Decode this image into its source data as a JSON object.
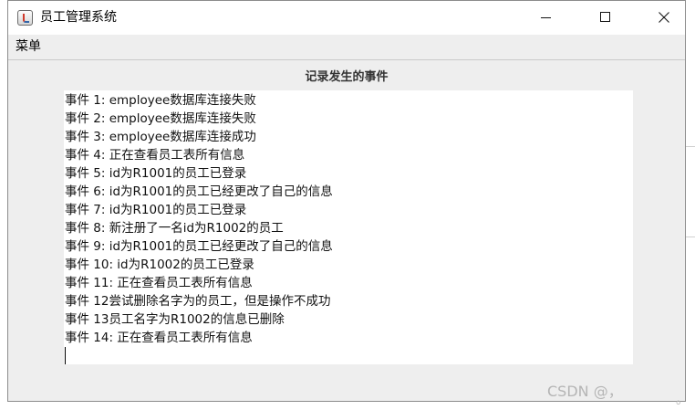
{
  "window": {
    "title": "员工管理系统"
  },
  "menubar": {
    "menu_label": "菜单"
  },
  "panel": {
    "title": "记录发生的事件"
  },
  "log": {
    "lines": [
      "事件 1: employee数据库连接失败",
      "事件 2: employee数据库连接失败",
      "事件 3: employee数据库连接成功",
      "事件 4: 正在查看员工表所有信息",
      "事件 5: id为R1001的员工已登录",
      "事件 6: id为R1001的员工已经更改了自己的信息",
      "事件 7: id为R1001的员工已登录",
      "事件 8: 新注册了一名id为R1002的员工",
      "事件 9: id为R1001的员工已经更改了自己的信息",
      "事件 10: id为R1002的员工已登录",
      "事件 11: 正在查看员工表所有信息",
      "事件 12尝试删除名字为的员工，但是操作不成功",
      "事件 13员工名字为R1002的信息已删除",
      "事件 14: 正在查看员工表所有信息"
    ]
  },
  "watermark": {
    "text": "CSDN @，",
    "dot": "。"
  },
  "icons": {
    "app": "java-cup-icon",
    "minimize": "minimize-icon",
    "maximize": "maximize-icon",
    "close": "close-icon"
  }
}
